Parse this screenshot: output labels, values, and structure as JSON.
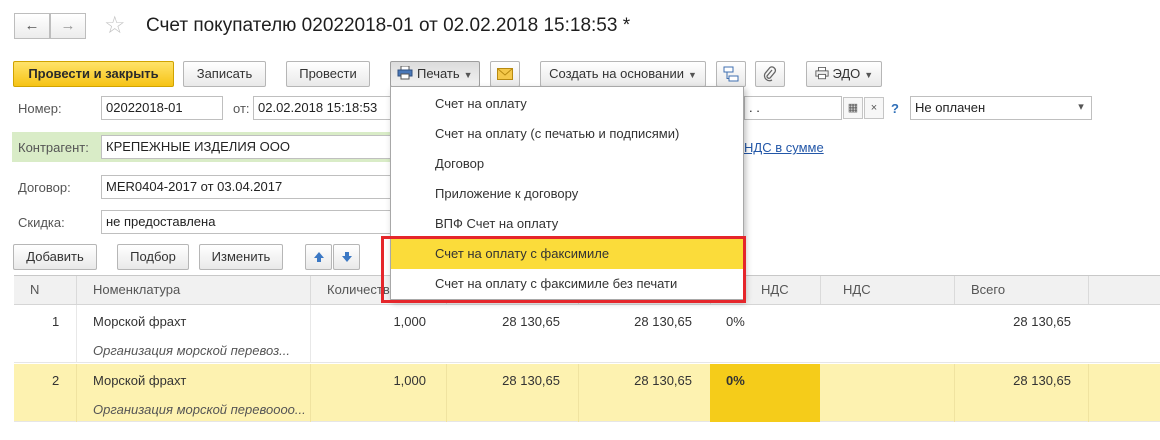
{
  "window": {
    "title": "Счет покупателю 02022018-01 от 02.02.2018 15:18:53 *",
    "back_icon": "←",
    "forward_icon": "→",
    "favorite_icon": "☆"
  },
  "toolbar": {
    "post_close": "Провести и закрыть",
    "save": "Записать",
    "post": "Провести",
    "print": "Печать",
    "create_based": "Создать на основании",
    "edo": "ЭДО"
  },
  "form": {
    "number_label": "Номер:",
    "number_value": "02022018-01",
    "date_label": "от:",
    "date_value": "02.02.2018 15:18:53",
    "pay_date_value": ". .",
    "pay_status_value": "Не оплачен",
    "counterparty_label": "Контрагент:",
    "counterparty_value": "КРЕПЕЖНЫЕ ИЗДЕЛИЯ ООО",
    "vat_link": "НДС в сумме",
    "contract_label": "Договор:",
    "contract_value": "MER0404-2017 от 03.04.2017",
    "discount_label": "Скидка:",
    "discount_value": "не предоставлена",
    "question_mark": "?"
  },
  "table_toolbar": {
    "add": "Добавить",
    "select": "Подбор",
    "change": "Изменить"
  },
  "table": {
    "columns": [
      "N",
      "Номенклатура",
      "Количество",
      "",
      "",
      "НДС",
      "НДС",
      "Всего"
    ],
    "rows": [
      {
        "n": "1",
        "name": "Морской фрахт",
        "desc": "Организация морской перевоз...",
        "qty": "1,000",
        "price": "28 130,65",
        "sum": "28 130,65",
        "vat_rate": "0%",
        "vat": "",
        "total": "28 130,65"
      },
      {
        "n": "2",
        "name": "Морской фрахт",
        "desc": "Организация морской перевоооо...",
        "qty": "1,000",
        "price": "28 130,65",
        "sum": "28 130,65",
        "vat_rate": "0%",
        "vat": "",
        "total": "28 130,65"
      }
    ]
  },
  "print_menu": {
    "items": [
      "Счет на оплату",
      "Счет на оплату (с печатью и подписями)",
      "Договор",
      "Приложение к договору",
      "ВПФ Счет на оплату",
      "Счет на оплату с факсимиле",
      "Счет на оплату с факсимиле без печати"
    ],
    "highlighted_index": 5
  },
  "colors": {
    "primary_button": "#f6c315",
    "selected_row": "#fdf2b0",
    "menu_highlight": "#fbdc3a",
    "annotation_frame": "#e5262b",
    "counterparty_bg": "#d9ecc7"
  }
}
